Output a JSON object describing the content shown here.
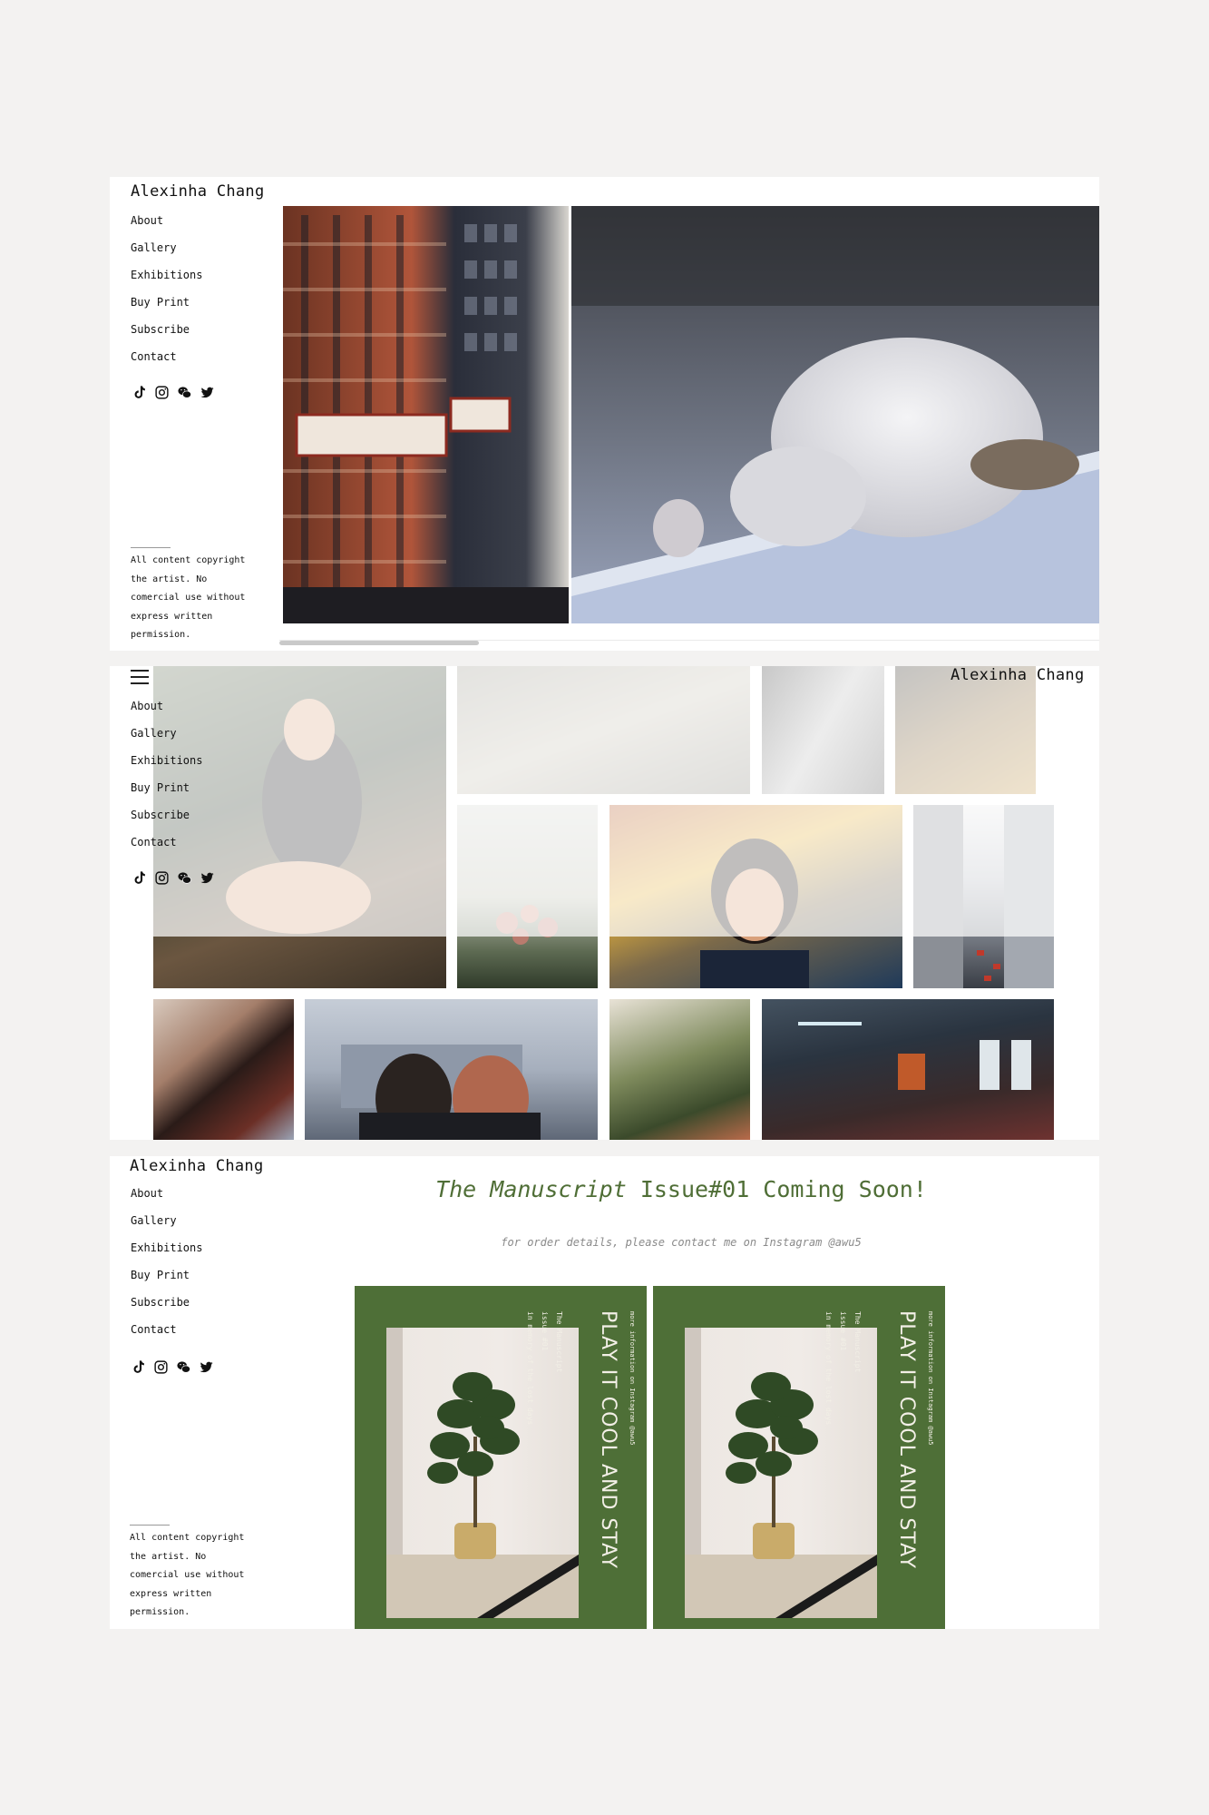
{
  "brand": "Alexinha Chang",
  "nav": [
    "About",
    "Gallery",
    "Exhibitions",
    "Buy Print",
    "Subscribe",
    "Contact"
  ],
  "social_icons": [
    "tiktok-icon",
    "instagram-icon",
    "wechat-icon",
    "twitter-icon"
  ],
  "copyright": "All content copyright the artist. No comercial use without express written permission.",
  "panel3": {
    "headline_italic": "The Manuscript",
    "headline_rest": " Issue#01 Coming Soon!",
    "subline": "for order details, please contact me on Instagram @awu5",
    "cover": {
      "title": "PLAY IT COOL AND STAY",
      "info": "more information on Instagram @awu5",
      "line1": "The Manuscript",
      "line2": "issue #01",
      "line3": "in memory of the lost days"
    }
  },
  "colors": {
    "accent_green": "#4e6f37",
    "headline_green": "#4f6e36"
  }
}
